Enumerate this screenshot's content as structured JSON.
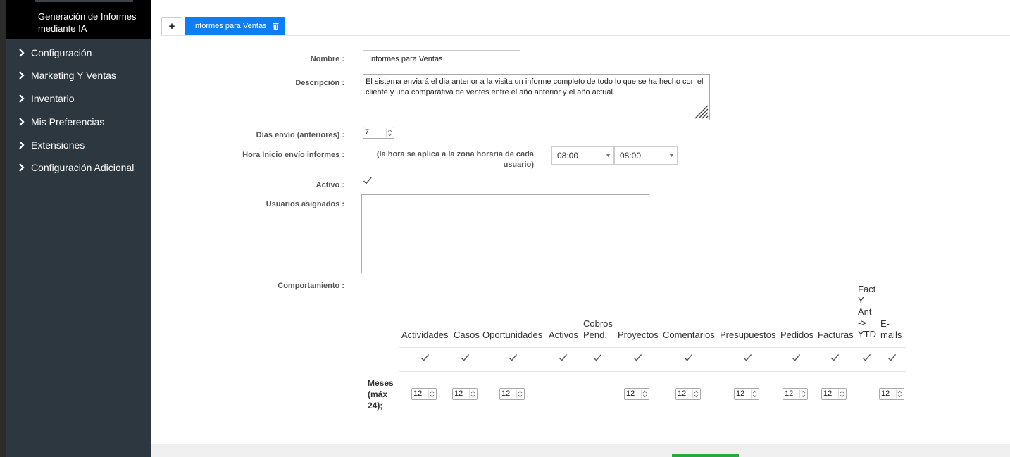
{
  "sidebar": {
    "active_item": "Generación de Informes mediante IA",
    "items": [
      {
        "label": "Configuración"
      },
      {
        "label": "Marketing Y Ventas"
      },
      {
        "label": "Inventario"
      },
      {
        "label": "Mis Preferencias"
      },
      {
        "label": "Extensiones"
      },
      {
        "label": "Configuración Adicional"
      }
    ]
  },
  "tabs": {
    "add_label": "+",
    "active_label": "Informes para Ventas"
  },
  "form": {
    "nombre_label": "Nombre :",
    "nombre_value": "Informes para Ventas",
    "descripcion_label": "Descripción :",
    "descripcion_value": "El sistema enviará el dia anterior a la visita un informe completo de todo lo que se ha hecho con el cliente y una comparativa de ventes entre el año anterior y el año actual.",
    "dias_label": "Días envío (anteriores) :",
    "dias_value": "7",
    "hora_label": "Hora Inicio envío informes :",
    "hora_note": "(la hora se aplica a la zona horaria de cada usuario)",
    "hora_from": "08:00",
    "hora_to": "08:00",
    "activo_label": "Activo :",
    "activo_checked": true,
    "usuarios_label": "Usuarios asignados :",
    "comportamiento_label": "Comportamiento :"
  },
  "behaviour": {
    "columns": [
      {
        "header": "Actividades",
        "checked": true,
        "months": "12"
      },
      {
        "header": "Casos",
        "checked": true,
        "months": "12"
      },
      {
        "header": "Oportunidades",
        "checked": true,
        "months": "12"
      },
      {
        "header": "Activos",
        "checked": true,
        "months": null
      },
      {
        "header": "Cobros Pend.",
        "checked": true,
        "months": null
      },
      {
        "header": "Proyectos",
        "checked": true,
        "months": "12"
      },
      {
        "header": "Comentarios",
        "checked": true,
        "months": "12"
      },
      {
        "header": "Presupuestos",
        "checked": true,
        "months": "12"
      },
      {
        "header": "Pedidos",
        "checked": true,
        "months": "12"
      },
      {
        "header": "Facturas",
        "checked": true,
        "months": "12"
      },
      {
        "header": "Fact Y Ant -> YTD",
        "checked": true,
        "months": null
      },
      {
        "header": "E-mails",
        "checked": true,
        "months": "12"
      }
    ],
    "months_row_label": "Meses (máx 24);"
  },
  "colors": {
    "sidebar_bg": "#2c3740",
    "tab_active": "#0d7ff2",
    "save_button": "#28a745"
  }
}
